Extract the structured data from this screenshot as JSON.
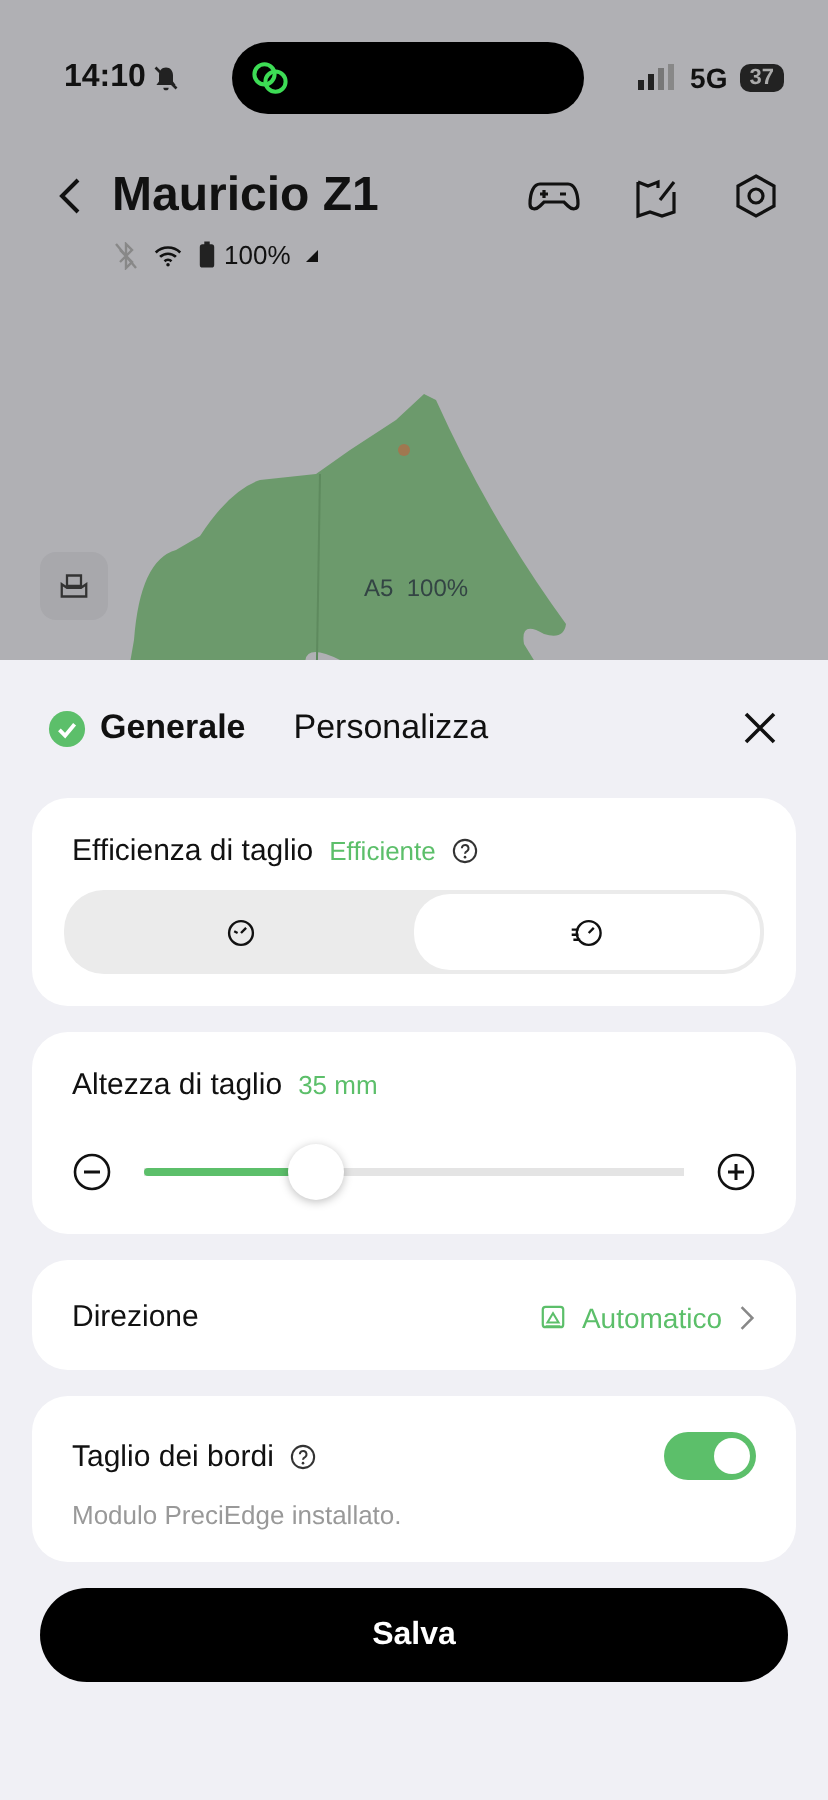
{
  "status_bar": {
    "time": "14:10",
    "network": "5G",
    "battery": "37"
  },
  "header": {
    "title": "Mauricio Z1",
    "battery": "100%"
  },
  "map": {
    "zone_label": "A5  100%"
  },
  "sheet": {
    "tabs": [
      {
        "label": "Generale",
        "selected": true
      },
      {
        "label": "Personalizza",
        "selected": false
      }
    ],
    "efficiency": {
      "label": "Efficienza di taglio",
      "value": "Efficiente",
      "options": [
        {
          "kind": "standard",
          "selected": false
        },
        {
          "kind": "fast",
          "selected": true
        }
      ]
    },
    "height": {
      "label": "Altezza di taglio",
      "value": "35 mm",
      "level": 0.32
    },
    "direction": {
      "label": "Direzione",
      "value": "Automatico"
    },
    "edge": {
      "label": "Taglio dei bordi",
      "note": "Modulo PreciEdge installato.",
      "on": true
    },
    "save": "Salva"
  }
}
